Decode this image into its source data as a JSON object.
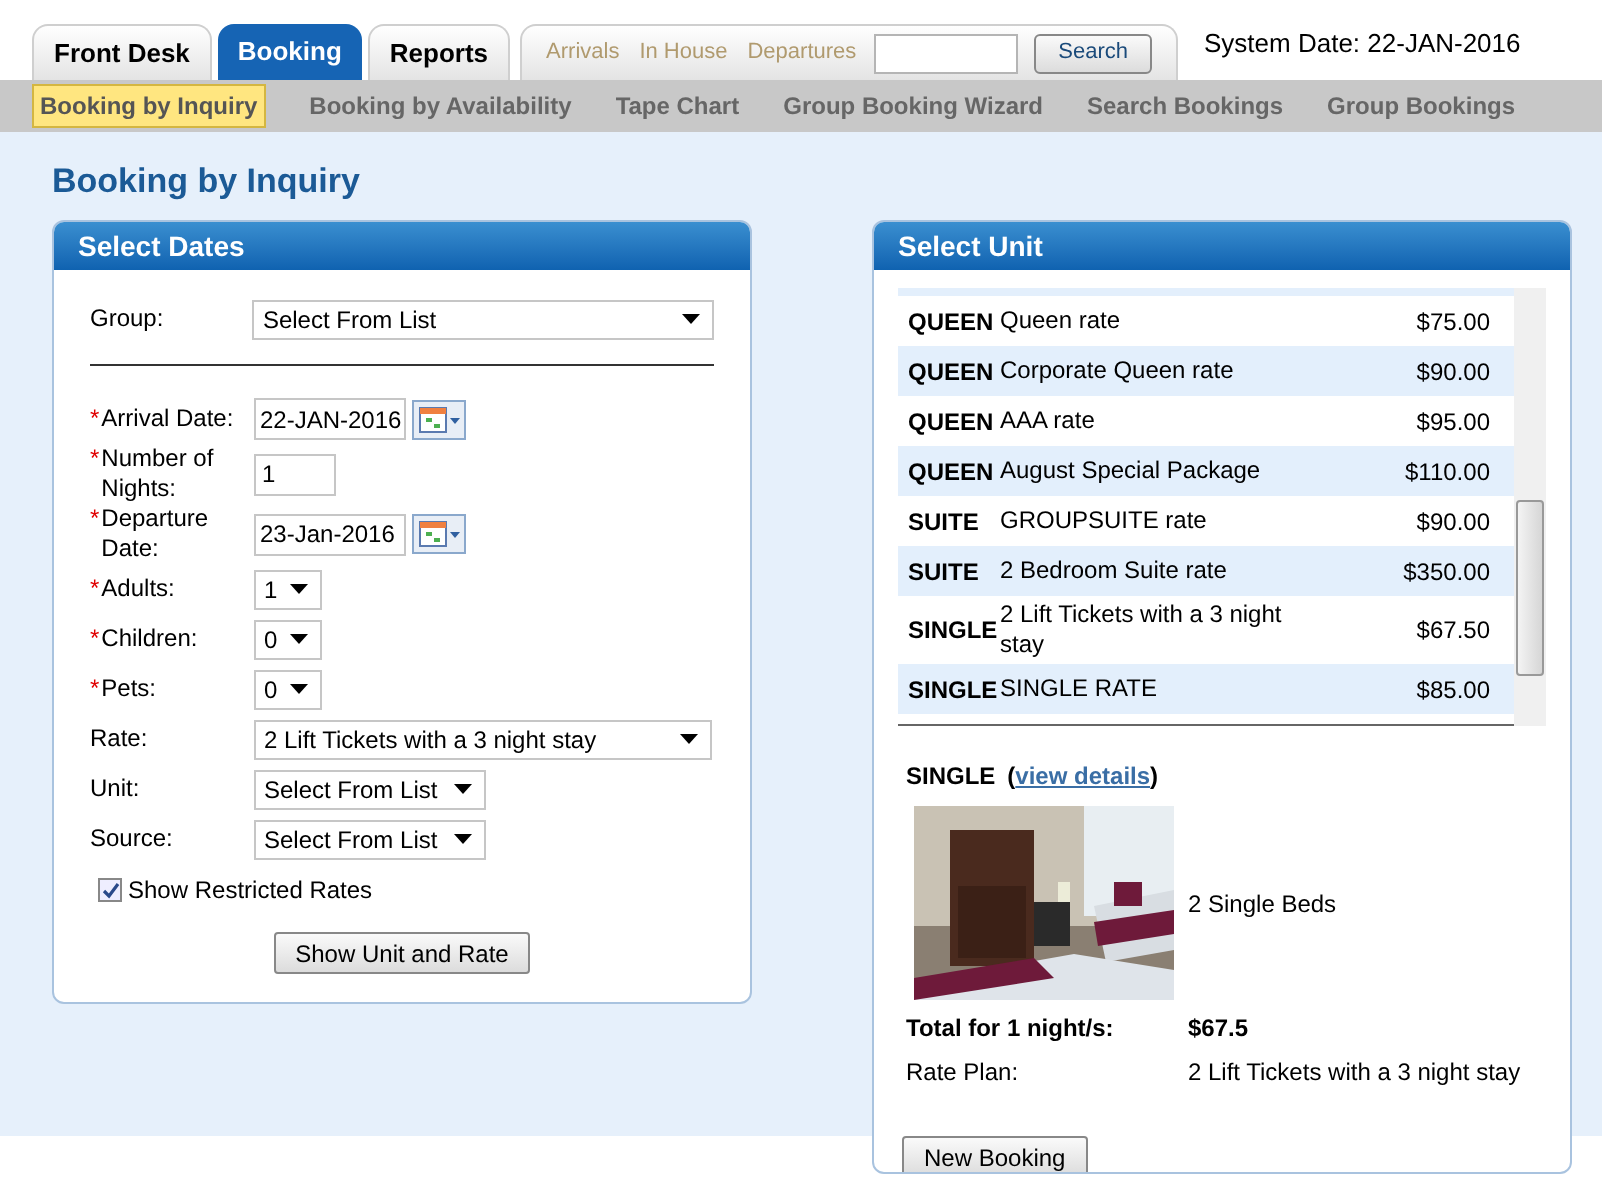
{
  "top_tabs": [
    {
      "label": "Front Desk",
      "selected": false
    },
    {
      "label": "Booking",
      "selected": true
    },
    {
      "label": "Reports",
      "selected": false
    }
  ],
  "quick_links": [
    "Arrivals",
    "In House",
    "Departures"
  ],
  "search": {
    "button": "Search"
  },
  "system_date": "System Date: 22-JAN-2016",
  "sub_nav": [
    {
      "label": "Booking by Inquiry",
      "selected": true
    },
    {
      "label": "Booking by Availability",
      "selected": false
    },
    {
      "label": "Tape Chart",
      "selected": false
    },
    {
      "label": "Group Booking Wizard",
      "selected": false
    },
    {
      "label": "Search Bookings",
      "selected": false
    },
    {
      "label": "Group Bookings",
      "selected": false
    }
  ],
  "page_title": "Booking by Inquiry",
  "select_dates": {
    "title": "Select Dates",
    "fields": [
      {
        "kind": "wide",
        "label": "Group:",
        "value": "Select From List"
      },
      {
        "kind": "date",
        "marker": "*",
        "label": "Arrival Date:",
        "value": "22-JAN-2016"
      },
      {
        "kind": "number",
        "marker": "*",
        "label": "Number of Nights:",
        "value": "1"
      },
      {
        "kind": "date",
        "marker": "*",
        "label": "Departure Date:",
        "value": "23-Jan-2016"
      },
      {
        "kind": "small",
        "marker": "*",
        "label": "Adults:",
        "value": "1"
      },
      {
        "kind": "small",
        "marker": "*",
        "label": "Children:",
        "value": "0"
      },
      {
        "kind": "small",
        "marker": "*",
        "label": "Pets:",
        "value": "0"
      },
      {
        "kind": "wide",
        "label": "Rate:",
        "value": "2 Lift Tickets with a 3 night stay"
      },
      {
        "kind": "medium",
        "label": "Unit:",
        "value": "Select From List"
      },
      {
        "kind": "medium",
        "label": "Source:",
        "value": "Select From List"
      }
    ],
    "checkbox": {
      "label": "Show Restricted Rates",
      "checked": true
    },
    "button": "Show Unit and Rate"
  },
  "select_unit": {
    "title": "Select Unit",
    "units": [
      {
        "unit": "QUEEN",
        "rate": "Queen rate",
        "price": "$75.00"
      },
      {
        "unit": "QUEEN",
        "rate": "Corporate Queen rate",
        "price": "$90.00"
      },
      {
        "unit": "QUEEN",
        "rate": "AAA rate",
        "price": "$95.00"
      },
      {
        "unit": "QUEEN",
        "rate": "August Special Package",
        "price": "$110.00"
      },
      {
        "unit": "SUITE",
        "rate": "GROUPSUITE rate",
        "price": "$90.00"
      },
      {
        "unit": "SUITE",
        "rate": "2 Bedroom Suite rate",
        "price": "$350.00"
      },
      {
        "unit": "SINGLE",
        "rate": "2 Lift Tickets with a 3 night stay",
        "price": "$67.50"
      },
      {
        "unit": "SINGLE",
        "rate": "SINGLE RATE",
        "price": "$85.00"
      }
    ],
    "detail": {
      "unit": "SINGLE",
      "link_open": "(",
      "link": "view details",
      "link_close": ")",
      "description": "2 Single Beds",
      "total_label": "Total for 1 night/s:",
      "total": "$67.5",
      "rate_plan_label": "Rate Plan:",
      "rate_plan": "2 Lift Tickets with a 3 night stay"
    },
    "button": "New Booking"
  }
}
